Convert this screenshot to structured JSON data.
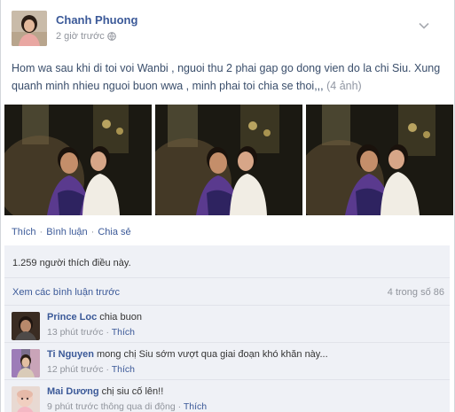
{
  "post": {
    "author": "Chanh Phuong",
    "timestamp": "2 giờ trước",
    "privacy_icon": "globe-icon",
    "menu_icon": "chevron-down-icon",
    "status_text": "Hom wa sau khi di toi voi Wanbi , nguoi thu 2 phai gap go dong vien do la chi Siu. Xung quanh minh nhieu nguoi buon wwa , minh phai toi chia se thoi,,,",
    "photo_count": "(4 ảnh)",
    "photos": [
      "photo-1",
      "photo-2",
      "photo-3"
    ]
  },
  "actions": {
    "like": "Thích",
    "comment": "Bình luận",
    "share": "Chia sẻ",
    "separator": "·"
  },
  "ufi": {
    "likes": "1.259 người thích điều này.",
    "view_previous": "Xem các bình luận trước",
    "comment_count": "4 trong số 86"
  },
  "comments": [
    {
      "author": "Prince Loc",
      "text": "chia buon",
      "time": "13 phút trước",
      "sep": "·",
      "like": "Thích"
    },
    {
      "author": "Ti Nguyen",
      "text": "mong chị Siu sớm vượt qua giai đoạn khó khăn này...",
      "time": "12 phút trước",
      "sep": "·",
      "like": "Thích"
    },
    {
      "author": "Mai Dương",
      "text": "chị siu cố lên!!",
      "time": "9 phút trước thông qua di động",
      "sep": "·",
      "like": "Thích"
    }
  ],
  "colors": {
    "link": "#3b5998",
    "ufi_bg": "#eff1f6",
    "muted": "#90949c"
  }
}
